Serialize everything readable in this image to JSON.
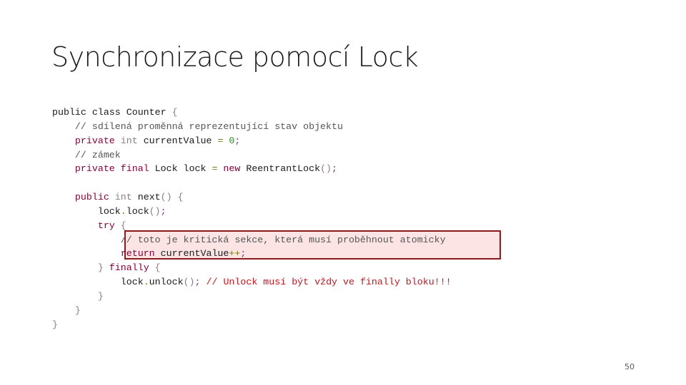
{
  "slide": {
    "title": "Synchronizace pomocí Lock",
    "page_number": "50",
    "highlight_color": "#8b1a1f",
    "highlight_fill": "#fde4e4"
  },
  "code": {
    "lines": [
      {
        "indent": "",
        "tokens": [
          {
            "t": "public class Counter ",
            "c": ""
          },
          {
            "t": "{",
            "c": "br"
          }
        ]
      },
      {
        "indent": "    ",
        "tokens": [
          {
            "t": "// sdílená proměnná reprezentující stav objektu",
            "c": "cm"
          }
        ]
      },
      {
        "indent": "    ",
        "tokens": [
          {
            "t": "private",
            "c": "kw"
          },
          {
            "t": " ",
            "c": ""
          },
          {
            "t": "int",
            "c": "ty"
          },
          {
            "t": " currentValue ",
            "c": ""
          },
          {
            "t": "=",
            "c": "op"
          },
          {
            "t": " ",
            "c": ""
          },
          {
            "t": "0",
            "c": "num"
          },
          {
            "t": ";",
            "c": "pn"
          }
        ]
      },
      {
        "indent": "    ",
        "tokens": [
          {
            "t": "// zámek",
            "c": "cm"
          }
        ]
      },
      {
        "indent": "    ",
        "tokens": [
          {
            "t": "private final",
            "c": "kw"
          },
          {
            "t": " Lock lock ",
            "c": ""
          },
          {
            "t": "=",
            "c": "op"
          },
          {
            "t": " ",
            "c": ""
          },
          {
            "t": "new",
            "c": "kw"
          },
          {
            "t": " ReentrantLock",
            "c": ""
          },
          {
            "t": "()",
            "c": "br"
          },
          {
            "t": ";",
            "c": "pn"
          }
        ]
      },
      {
        "indent": "",
        "tokens": []
      },
      {
        "indent": "    ",
        "tokens": [
          {
            "t": "public",
            "c": "kw"
          },
          {
            "t": " ",
            "c": ""
          },
          {
            "t": "int",
            "c": "ty"
          },
          {
            "t": " next",
            "c": ""
          },
          {
            "t": "()",
            "c": "br"
          },
          {
            "t": " ",
            "c": ""
          },
          {
            "t": "{",
            "c": "br"
          }
        ]
      },
      {
        "indent": "        ",
        "tokens": [
          {
            "t": "lock",
            "c": ""
          },
          {
            "t": ".",
            "c": "op"
          },
          {
            "t": "lock",
            "c": ""
          },
          {
            "t": "()",
            "c": "br"
          },
          {
            "t": ";",
            "c": "pn"
          }
        ]
      },
      {
        "indent": "        ",
        "tokens": [
          {
            "t": "try",
            "c": "kw"
          },
          {
            "t": " ",
            "c": ""
          },
          {
            "t": "{",
            "c": "br"
          }
        ]
      },
      {
        "indent": "            ",
        "tokens": [
          {
            "t": "// toto je kritická sekce, která musí proběhnout atomicky",
            "c": "cm"
          }
        ]
      },
      {
        "indent": "            ",
        "tokens": [
          {
            "t": "return",
            "c": "kw"
          },
          {
            "t": " currentValue",
            "c": ""
          },
          {
            "t": "++",
            "c": "op"
          },
          {
            "t": ";",
            "c": "pn"
          }
        ]
      },
      {
        "indent": "        ",
        "tokens": [
          {
            "t": "}",
            "c": "br"
          },
          {
            "t": " ",
            "c": ""
          },
          {
            "t": "finally",
            "c": "kw"
          },
          {
            "t": " ",
            "c": ""
          },
          {
            "t": "{",
            "c": "br"
          }
        ]
      },
      {
        "indent": "            ",
        "tokens": [
          {
            "t": "lock",
            "c": ""
          },
          {
            "t": ".",
            "c": "op"
          },
          {
            "t": "unlock",
            "c": ""
          },
          {
            "t": "()",
            "c": "br"
          },
          {
            "t": ";",
            "c": "pn"
          },
          {
            "t": " ",
            "c": ""
          },
          {
            "t": "// Unlock musí být vždy ve finally bloku!!!",
            "c": "cm-red"
          }
        ]
      },
      {
        "indent": "        ",
        "tokens": [
          {
            "t": "}",
            "c": "br"
          }
        ]
      },
      {
        "indent": "    ",
        "tokens": [
          {
            "t": "}",
            "c": "br"
          }
        ]
      },
      {
        "indent": "",
        "tokens": [
          {
            "t": "}",
            "c": "br"
          }
        ]
      }
    ]
  }
}
